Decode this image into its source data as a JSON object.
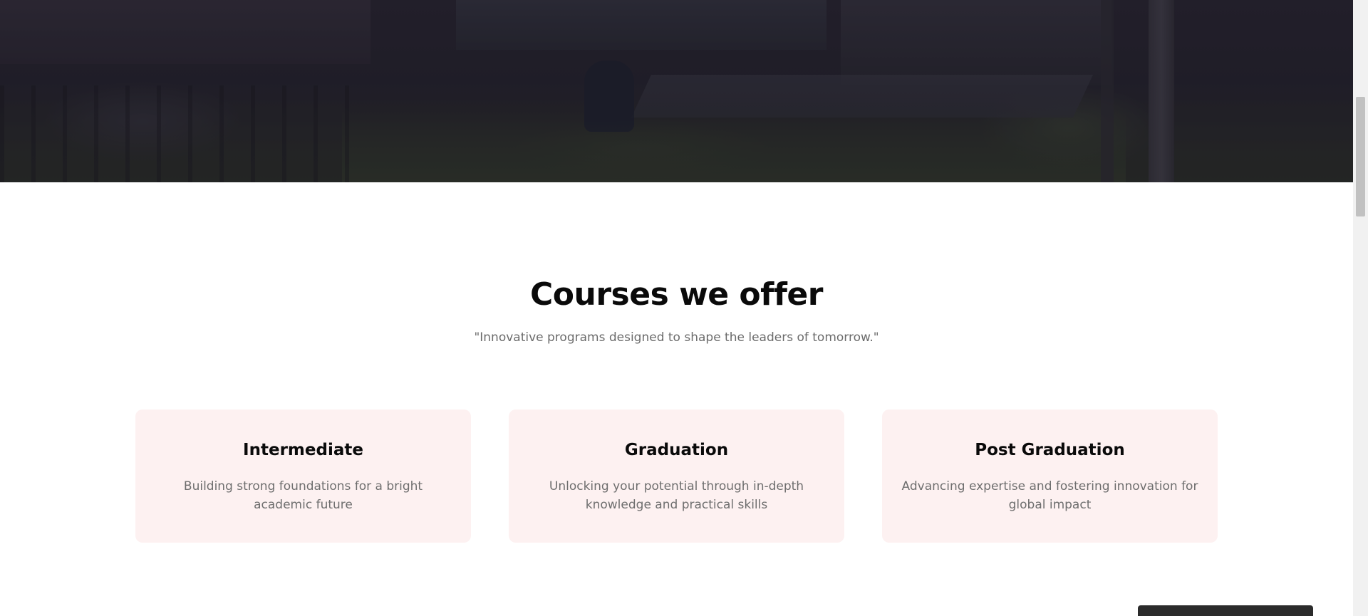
{
  "hero": {
    "image_alt": "campus photo"
  },
  "courses": {
    "title": "Courses we offer",
    "subtitle": "\"Innovative programs designed to shape the leaders of tomorrow.\"",
    "items": [
      {
        "title": "Intermediate",
        "description": "Building strong foundations for a bright academic future"
      },
      {
        "title": "Graduation",
        "description": "Unlocking your potential through in-depth knowledge and practical skills"
      },
      {
        "title": "Post Graduation",
        "description": "Advancing expertise and fostering innovation for global impact"
      }
    ]
  },
  "toast": {
    "text": ""
  },
  "colors": {
    "card_background": "#fdf1f1",
    "heading": "#0a0a0a",
    "body_text": "#6e6e6e",
    "toast_background": "#2b2b2b"
  }
}
